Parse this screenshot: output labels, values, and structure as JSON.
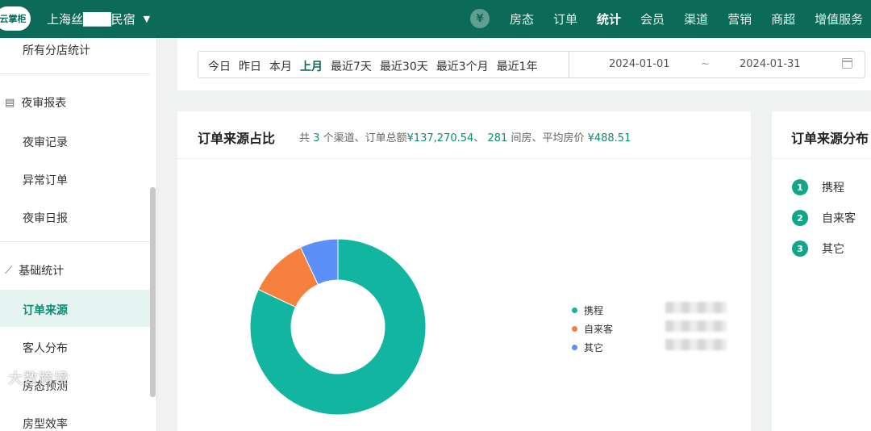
{
  "topbar": {
    "logo_text": "云掌柜",
    "hotel_name": "上海丝███民宿",
    "nav": [
      "房态",
      "订单",
      "统计",
      "会员",
      "渠道",
      "营销",
      "商超",
      "增值服务"
    ],
    "active_nav": "统计",
    "yen_symbol": "¥"
  },
  "sidebar": {
    "all_store_stats": "所有分店统计",
    "night_audit_group": "夜审报表",
    "night_audit_items": [
      "夜审记录",
      "异常订单",
      "夜审日报"
    ],
    "basic_stats_group": "基础统计",
    "basic_stats_items": [
      "订单来源",
      "客人分布",
      "房态预测",
      "房型效率"
    ],
    "active_item": "订单来源",
    "watermark": "大数跨境"
  },
  "date_filter": {
    "ranges": [
      "今日",
      "昨日",
      "本月",
      "上月",
      "最近7天",
      "最近30天",
      "最近3个月",
      "最近1年"
    ],
    "selected": "上月",
    "start": "2024-01-01",
    "separator": "~",
    "end": "2024-01-31"
  },
  "order_source_card": {
    "title": "订单来源占比",
    "subtitle_prefix": "共",
    "channel_count": "3",
    "subtitle_mid": "个渠道、订单总额",
    "total_amount": "¥137,270.54",
    "sep": "、",
    "room_nights": "281",
    "subtitle_rooms": "间房、平均房价",
    "avg_price": "¥488.51"
  },
  "chart_data": {
    "type": "pie",
    "donut": true,
    "categories": [
      "携程",
      "自来客",
      "其它"
    ],
    "values": [
      82,
      11,
      7
    ],
    "colors": [
      "#12b5a0",
      "#f5803e",
      "#5b8ff9"
    ],
    "legend_position": "right"
  },
  "distribution_card": {
    "title": "订单来源分布",
    "items": [
      "携程",
      "自来客",
      "其它"
    ]
  }
}
